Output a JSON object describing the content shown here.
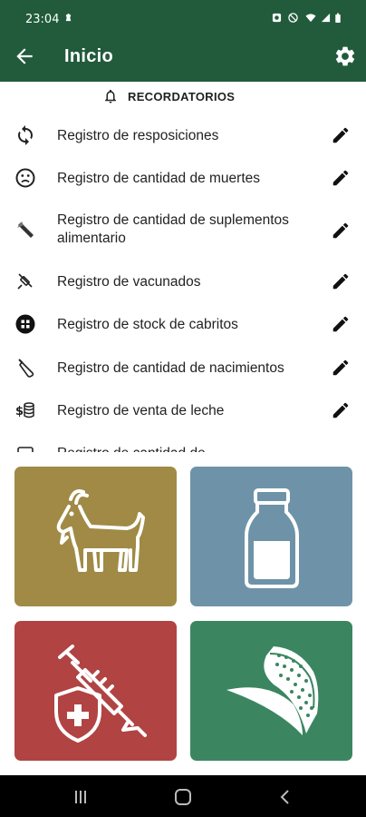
{
  "status_bar": {
    "time": "23:04",
    "icons": [
      "notification-icon",
      "alarm-icon",
      "mute-icon",
      "wifi-icon",
      "signal-icon",
      "battery-icon"
    ]
  },
  "app_bar": {
    "title": "Inicio",
    "back_icon": "arrow-back-icon",
    "settings_icon": "gear-icon",
    "color": "#215b3c"
  },
  "reminders": {
    "title": "RECORDATORIOS",
    "icon": "bell-icon",
    "items": [
      {
        "label": "Registro de resposiciones",
        "icon": "sync-icon"
      },
      {
        "label": "Registro de cantidad de muertes",
        "icon": "sad-face-icon"
      },
      {
        "label": "Registro de cantidad de suplementos alimentario",
        "icon": "feed-icon"
      },
      {
        "label": "Registro de vacunados",
        "icon": "vaccine-icon"
      },
      {
        "label": "Registro de stock de cabritos",
        "icon": "stock-icon"
      },
      {
        "label": "Registro de cantidad de nacimientos",
        "icon": "bottle-icon"
      },
      {
        "label": "Registro de venta de leche",
        "icon": "money-icon"
      },
      {
        "label": "Registro de cantidad de",
        "icon": "generic-icon"
      }
    ],
    "edit_icon": "pencil-icon"
  },
  "tiles": [
    {
      "name": "goats",
      "icon": "goat-icon",
      "color": "#a08a45"
    },
    {
      "name": "milk",
      "icon": "milk-bottle-icon",
      "color": "#6e93a8"
    },
    {
      "name": "vaccines",
      "icon": "vaccine-shield-icon",
      "color": "#b14343"
    },
    {
      "name": "feed",
      "icon": "corn-icon",
      "color": "#3b8660"
    }
  ],
  "nav_bar": {
    "icons": [
      "recents-icon",
      "home-icon",
      "back-icon"
    ]
  }
}
